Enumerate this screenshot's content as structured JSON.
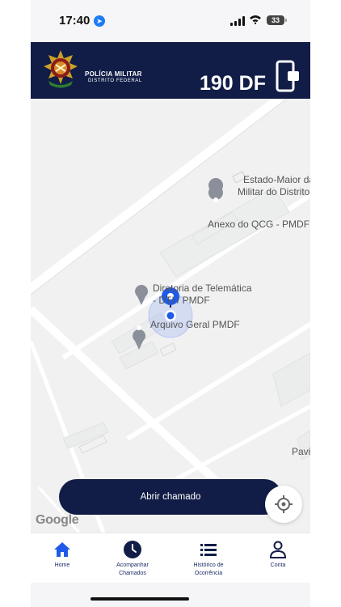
{
  "status": {
    "time": "17:40",
    "battery": "33"
  },
  "header": {
    "brand_line1": "POLÍCIA MILITAR",
    "brand_line2": "DISTRITO FEDERAL",
    "title": "190 DF"
  },
  "map": {
    "labels": [
      "Estado-Maior da",
      "Militar do Distrito",
      "Anexo do QCG - PMDF",
      "Diretoria de Telemática",
      "- DTI / PMDF",
      "Arquivo Geral PMDF",
      "Pavi"
    ],
    "attribution": "Google"
  },
  "actions": {
    "open_call": "Abrir chamado"
  },
  "tabs": [
    {
      "label": "Home",
      "icon": "home-icon"
    },
    {
      "label": "Acompanhar Chamados",
      "icon": "clock-icon"
    },
    {
      "label": "Histórico de Ocorrência",
      "icon": "list-icon"
    },
    {
      "label": "Conta",
      "icon": "user-icon"
    }
  ],
  "colors": {
    "navy": "#111d47",
    "accent_blue": "#1f5be8",
    "tab_active": "#1b2a63"
  }
}
